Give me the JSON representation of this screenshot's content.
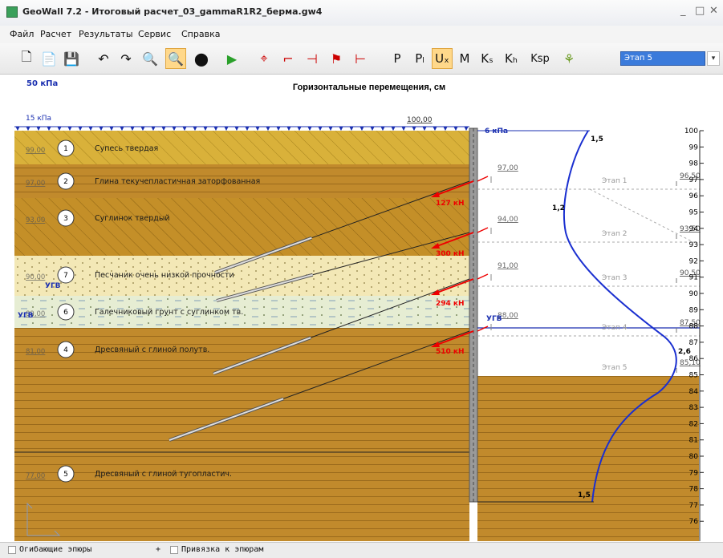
{
  "window": {
    "title": "GeoWall 7.2  -  Итоговый расчет_03_gammaR1R2_берма.gw4"
  },
  "menu": [
    "Файл",
    "Расчет",
    "Результаты",
    "Сервис",
    "Справка"
  ],
  "toolbar": {
    "letters": [
      "P",
      "Pₗ",
      "Uₓ",
      "M",
      "Kₛ",
      "Kₕ",
      "Ksp"
    ],
    "stage_selected": "Этап 5"
  },
  "canvas": {
    "title": "Горизонтальные перемещения, см",
    "top_load": "50 кПа",
    "left_load": "15 кПа",
    "right_load": "6 кПа",
    "load_level": "100,00",
    "layers": [
      {
        "num": "1",
        "name": "Супесь твердая",
        "level": "99,00"
      },
      {
        "num": "2",
        "name": "Глина текучепластичная заторфованная",
        "level": "97,00"
      },
      {
        "num": "3",
        "name": "Суглинок твердый",
        "level": "93,00"
      },
      {
        "num": "7",
        "name": "Песчаник очень низкой прочности",
        "level": "90,00"
      },
      {
        "num": "6",
        "name": "Галечниковый грунт с суглинком тв.",
        "level": "89,00"
      },
      {
        "num": "4",
        "name": "Дресвяный с глиной полутв.",
        "level": "81,00"
      },
      {
        "num": "5",
        "name": "Дресвяный с глиной тугопластич.",
        "level": "77,00"
      }
    ],
    "ugv_left": "УГВ",
    "ugv_left2": "УГВ",
    "ugv_right": "УГВ",
    "anchor_forces": [
      "127 кН",
      "300 кН",
      "294 кН",
      "510 кН"
    ],
    "excavation_levels": [
      "97,00",
      "94,00",
      "91,00",
      "88,00"
    ],
    "stages": [
      {
        "label": "Этап 1",
        "level": "96,50"
      },
      {
        "label": "Этап 2",
        "level": "93,50"
      },
      {
        "label": "Этап 3",
        "level": "90,50"
      },
      {
        "label": "Этап 4",
        "level": "87,50"
      },
      {
        "label": "Этап 5",
        "level": "85,10"
      }
    ],
    "curve_values": [
      "1,5",
      "1,2",
      "2,6",
      "1,5"
    ],
    "axis_ticks": [
      "100",
      "99",
      "98",
      "97",
      "96",
      "95",
      "94",
      "93",
      "92",
      "91",
      "90",
      "89",
      "88",
      "87",
      "86",
      "85",
      "84",
      "83",
      "82",
      "81",
      "80",
      "79",
      "78",
      "77",
      "76"
    ]
  },
  "status": {
    "envelopes": "Огибающие эпюры",
    "binding": "Привязка к эпюрам",
    "plus": "+"
  }
}
